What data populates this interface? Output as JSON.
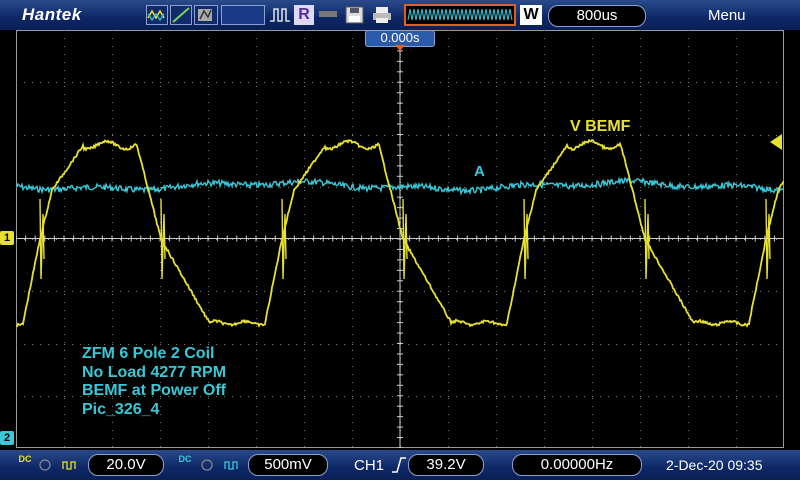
{
  "header": {
    "brand": "Hantek",
    "run_state": "R",
    "acq_mode_label": "W",
    "timebase": "800us",
    "menu_label": "Menu"
  },
  "screen": {
    "time_position": "0.000s",
    "ch1_marker": "1",
    "ch2_marker": "2",
    "trace_labels": {
      "ch1": "V BEMF",
      "ch2": "A"
    },
    "note_lines": [
      "ZFM 6 Pole 2 Coil",
      "No Load 4277 RPM",
      "BEMF at Power Off",
      "Pic_326_4"
    ]
  },
  "footer": {
    "ch1_coupling": "DC",
    "ch1_scale": "20.0V",
    "ch2_coupling": "DC",
    "ch2_scale": "500mV",
    "trigger_source": "CH1",
    "trigger_level": "39.2V",
    "frequency": "0.00000Hz",
    "datetime": "2-Dec-20 09:35"
  },
  "colors": {
    "ch1": "#e8e030",
    "ch2": "#38c8d8",
    "background": "#000000",
    "bar": "#0d2766"
  }
}
